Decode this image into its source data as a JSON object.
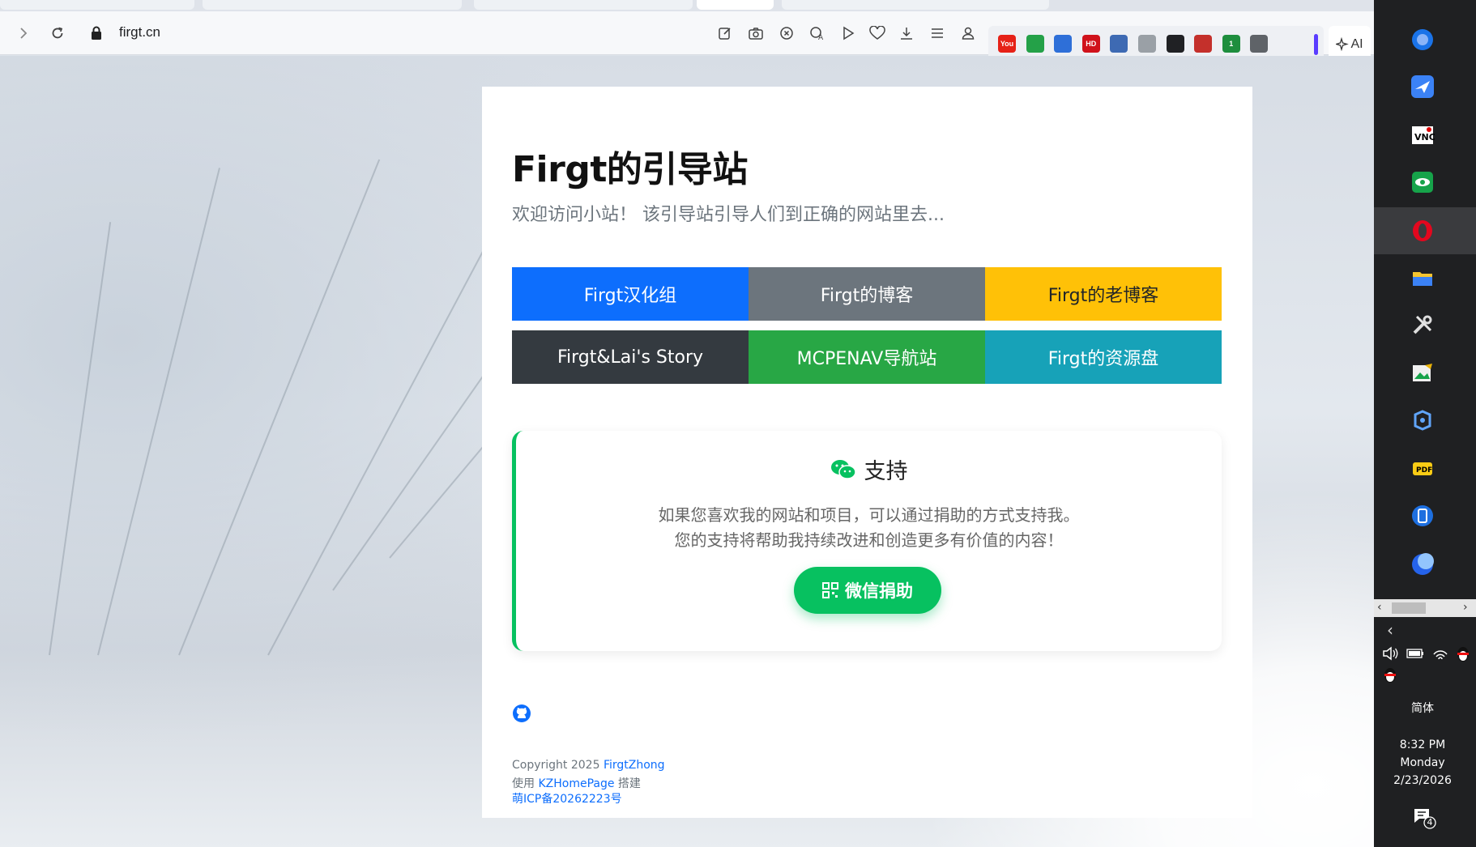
{
  "browser": {
    "url": "firgt.cn",
    "ai_label": "AI",
    "extensions": [
      {
        "name": "youtube-ext-icon",
        "color": "#e62117",
        "label": "You"
      },
      {
        "name": "download-arrow-green-icon",
        "color": "#24a148",
        "label": ""
      },
      {
        "name": "download-arrow-blue-icon",
        "color": "#2e6fd8",
        "label": ""
      },
      {
        "name": "hd-ext-icon",
        "color": "#d0121b",
        "label": "HD"
      },
      {
        "name": "pencil-ext-icon",
        "color": "#3e6ab3",
        "label": ""
      },
      {
        "name": "diamond-ext-icon",
        "color": "#9aa0a6",
        "label": ""
      },
      {
        "name": "clapper-ext-icon",
        "color": "#202124",
        "label": ""
      },
      {
        "name": "youtube-tv-ext-icon",
        "color": "#c4302b",
        "label": ""
      },
      {
        "name": "badge-ext-icon",
        "color": "#1e8e3e",
        "label": "1"
      },
      {
        "name": "cube-ext-icon",
        "color": "#5f6368",
        "label": ""
      }
    ]
  },
  "page": {
    "title": "Firgt的引导站",
    "subtitle": "欢迎访问小站！ 该引导站引导人们到正确的网站里去...",
    "links": [
      {
        "label": "Firgt汉化组",
        "color": "#0d6efd"
      },
      {
        "label": "Firgt的博客",
        "color": "#6c757d"
      },
      {
        "label": "Firgt的老博客",
        "color": "#ffc107"
      },
      {
        "label": "Firgt&Lai's Story",
        "color": "#343a40"
      },
      {
        "label": "MCPENAV导航站",
        "color": "#28a745"
      },
      {
        "label": "Firgt的资源盘",
        "color": "#17a2b8"
      }
    ],
    "support": {
      "title": "支持",
      "line1": "如果您喜欢我的网站和项目，可以通过捐助的方式支持我。",
      "line2": "您的支持将帮助我持续改进和创造更多有价值的内容！",
      "button_label": "微信捐助",
      "accent": "#07c160"
    },
    "footer": {
      "copyright_prefix": "Copyright 2025 ",
      "author": "FirgtZhong",
      "built_prefix": "使用 ",
      "builder": "KZHomePage",
      "built_suffix": " 搭建",
      "icp": "萌ICP备20262223号"
    }
  },
  "taskbar": {
    "ime": "简体",
    "time": "8:32 PM",
    "day": "Monday",
    "date": "2/23/2026",
    "notifications": "4"
  }
}
